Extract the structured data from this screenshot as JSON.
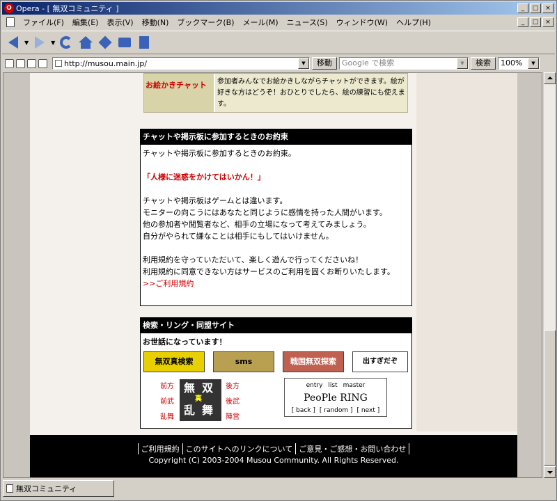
{
  "window": {
    "title": "Opera - [ 無双コミュニティ ]",
    "app_icon": "O"
  },
  "window_controls": [
    "_",
    "□",
    "×"
  ],
  "menu": [
    "ファイル(F)",
    "編集(E)",
    "表示(V)",
    "移動(N)",
    "ブックマーク(B)",
    "メール(M)",
    "ニュース(S)",
    "ウィンドウ(W)",
    "ヘルプ(H)"
  ],
  "address": {
    "url": "http://musou.main.jp/",
    "go_label": "移動",
    "search_placeholder": "Google で検索",
    "search_label": "検索",
    "zoom": "100%"
  },
  "chat_box": {
    "label": "お絵かきチャット",
    "desc": "参加者みんなでお絵かきしながらチャットができます。絵が好きな方はどうぞ！おひとりでしたら、絵の練習にも使えます。"
  },
  "promise": {
    "heading": "チャットや掲示板に参加するときのお約束",
    "intro": "チャットや掲示板に参加するときのお約束。",
    "slogan": "「人様に迷惑をかけてはいかん！」",
    "lines": [
      "チャットや掲示板はゲームとは違います。",
      "モニターの向こうにはあなたと同じように感情を持った人間がいます。",
      "他の参加者や閲覧者など、相手の立場になって考えてみましょう。",
      "自分がやられて嫌なことは相手にもしてはいけません。"
    ],
    "lines2": [
      "利用規約を守っていただいて、楽しく遊んで行ってくださいね！",
      "利用規約に同意できない方はサービスのご利用を固くお断りいたします。"
    ],
    "link": ">>ご利用規約"
  },
  "links_section": {
    "heading": "検索・リング・同盟サイト",
    "thanks": "お世話になっています！",
    "banners": [
      "無双真検索",
      "sms",
      "戦国無双探索",
      "出すぎだぞ"
    ],
    "musou": {
      "left": [
        "前方",
        "前武",
        "乱舞"
      ],
      "right": [
        "後方",
        "後武",
        "陣営"
      ],
      "center": [
        "無",
        "双",
        "真",
        "乱",
        "舞"
      ]
    },
    "ring": {
      "top": [
        "entry",
        "list",
        "master"
      ],
      "title": "PeoPle RING",
      "bottom": [
        "[ back ]",
        "[ random ]",
        "[ next ]"
      ]
    }
  },
  "footer": {
    "links": [
      "ご利用規約",
      "このサイトへのリンクについて",
      "ご意見・ご感想・お問い合わせ"
    ],
    "copyright": "Copyright (C) 2003-2004 Musou Community. All Rights Reserved."
  },
  "statusbar": {
    "tab_label": "無双コミュニティ"
  }
}
